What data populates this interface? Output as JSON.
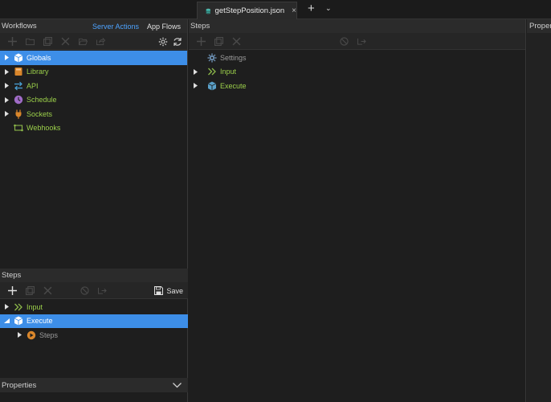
{
  "tab": {
    "title": "getStepPosition.json",
    "close": "×"
  },
  "workflows": {
    "title": "Workflows",
    "subtabs": [
      "Server Actions",
      "App Flows"
    ],
    "tree": [
      {
        "label": "Globals",
        "icon": "cube-icon",
        "selected": true
      },
      {
        "label": "Library",
        "icon": "book-icon"
      },
      {
        "label": "API",
        "icon": "exchange-icon"
      },
      {
        "label": "Schedule",
        "icon": "clock-icon"
      },
      {
        "label": "Sockets",
        "icon": "plug-icon"
      },
      {
        "label": "Webhooks",
        "icon": "webhook-icon"
      }
    ]
  },
  "steps_panel": {
    "title": "Steps",
    "tree": [
      {
        "label": "Settings",
        "icon": "gear-icon"
      },
      {
        "label": "Input",
        "icon": "chevrons-right-icon"
      },
      {
        "label": "Execute",
        "icon": "cube-icon"
      }
    ]
  },
  "bottom_steps": {
    "title": "Steps",
    "save_label": "Save",
    "tree": [
      {
        "label": "Input",
        "icon": "chevrons-right-icon"
      },
      {
        "label": "Execute",
        "icon": "cube-icon",
        "selected": true
      },
      {
        "label": "Steps",
        "icon": "play-circle-icon"
      }
    ]
  },
  "properties": {
    "title": "Properties"
  },
  "right_panel": {
    "title": "Proper"
  },
  "colors": {
    "accent": "#3d8ee8",
    "green": "#9bcf4a",
    "link": "#4da3ff"
  }
}
